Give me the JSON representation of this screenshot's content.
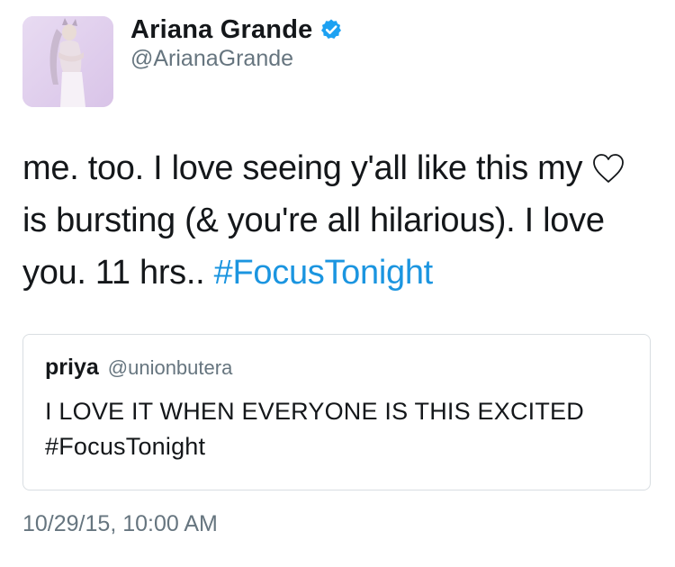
{
  "author": {
    "display_name": "Ariana Grande",
    "handle": "@ArianaGrande",
    "verified": true,
    "avatar_icon": "profile-photo",
    "verified_icon": "verified-badge-icon",
    "verified_color": "#1da1f2"
  },
  "tweet": {
    "text_part1": "me. too. I love seeing y'all like this my",
    "heart_icon": "heart-outline-icon",
    "text_part2": "is bursting (& you're all hilarious). I love you. 11 hrs..",
    "hashtag": "#FocusTonight",
    "hashtag_color": "#1b95e0"
  },
  "quoted_tweet": {
    "name": "priya",
    "handle": "@unionbutera",
    "text": "I LOVE IT WHEN EVERYONE IS THIS EXCITED #FocusTonight"
  },
  "timestamp": "10/29/15, 10:00 AM"
}
